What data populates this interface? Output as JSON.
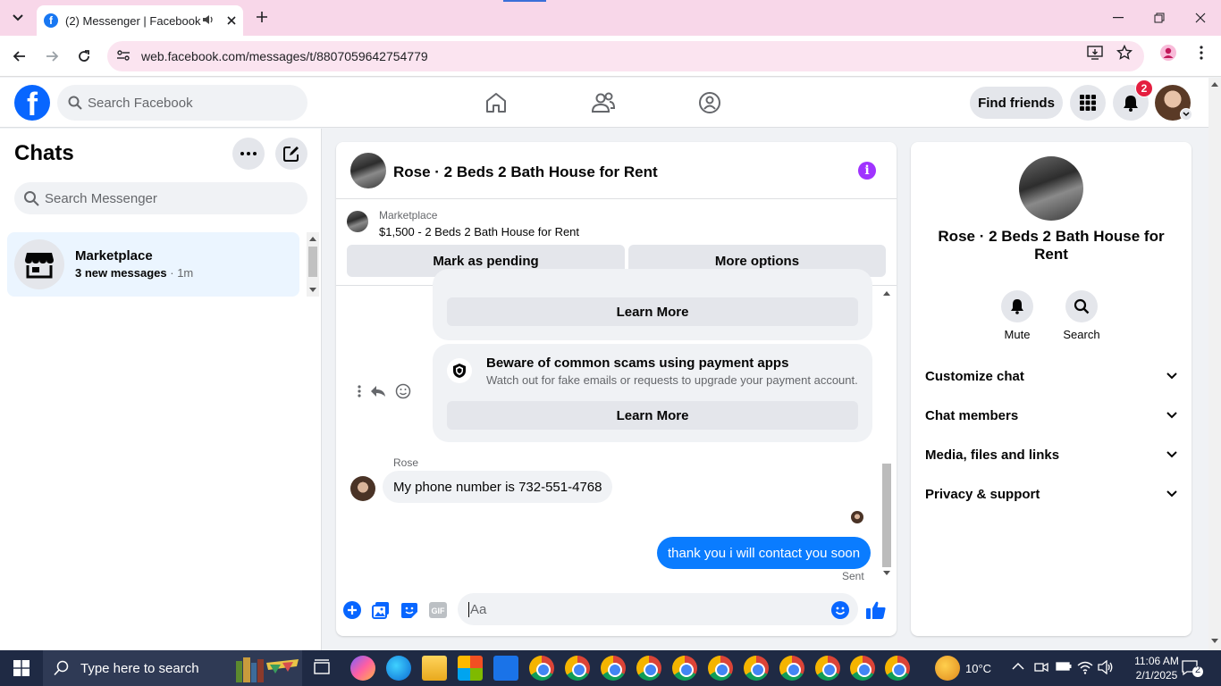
{
  "browser": {
    "tab_title": "(2) Messenger | Facebook",
    "url": "web.facebook.com/messages/t/8807059642754779"
  },
  "fbnav": {
    "search_placeholder": "Search Facebook",
    "find_friends": "Find friends",
    "notification_count": "2"
  },
  "sidebar": {
    "title": "Chats",
    "search_placeholder": "Search Messenger",
    "conversations": [
      {
        "name": "Marketplace",
        "preview": "3 new messages",
        "time": "· 1m"
      }
    ]
  },
  "conversation": {
    "title": "Rose · 2 Beds 2 Bath House for Rent",
    "marketplace_label": "Marketplace",
    "listing": "$1,500 - 2 Beds 2 Bath House for Rent",
    "mark_pending": "Mark as pending",
    "more_options": "More options",
    "cards": [
      {
        "button": "Learn More"
      },
      {
        "title": "Beware of common scams using payment apps",
        "description": "Watch out for fake emails or requests to upgrade your payment account.",
        "button": "Learn More"
      }
    ],
    "sender_name": "Rose",
    "incoming_message": "My phone number is 732-551-4768",
    "outgoing_message": "thank you i will contact you soon",
    "status": "Sent",
    "composer_placeholder": "Aa"
  },
  "details": {
    "title": "Rose · 2 Beds 2 Bath House for Rent",
    "mute": "Mute",
    "search": "Search",
    "sections": [
      "Customize chat",
      "Chat members",
      "Media, files and links",
      "Privacy & support"
    ]
  },
  "taskbar": {
    "search_placeholder": "Type here to search",
    "weather": "10°C",
    "time": "11:06 AM",
    "date": "2/1/2025",
    "notifications": "2"
  },
  "colors": {
    "brand_blue": "#0866ff",
    "outgoing_bubble": "#0a7cff",
    "info_purple": "#a033ff",
    "badge_red": "#e41e3f",
    "chrome_tabstrip": "#f8d7e9"
  }
}
